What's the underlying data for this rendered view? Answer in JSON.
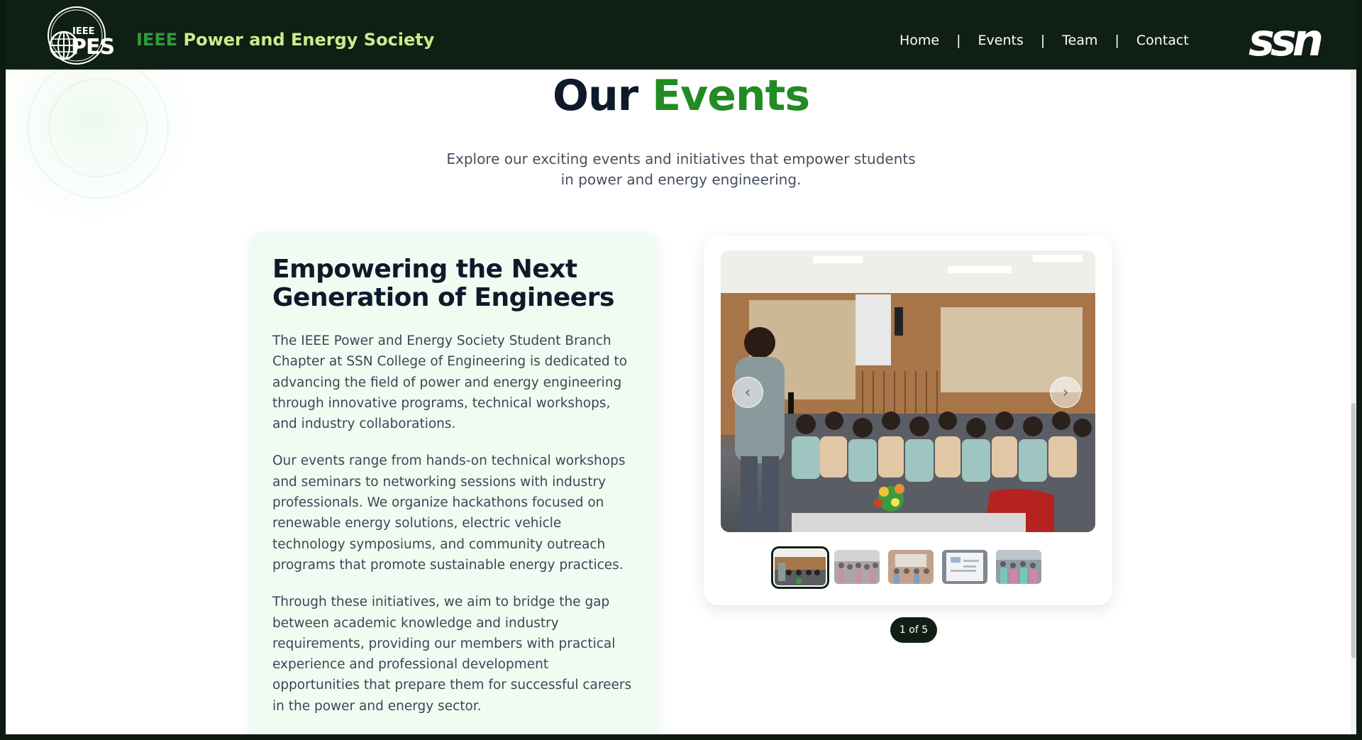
{
  "header": {
    "brand_ieee": "IEEE",
    "brand_rest": "Power and Energy Society",
    "logo_top": "IEEE",
    "logo_bottom": "PES",
    "nav": [
      "Home",
      "Events",
      "Team",
      "Contact"
    ],
    "nav_separator": "|",
    "partner_logo_text": "ssn"
  },
  "hero": {
    "title_part1": "Our",
    "title_part2": "Events",
    "subtitle": "Explore our exciting events and initiatives that empower students in power and energy engineering."
  },
  "about": {
    "heading": "Empowering the Next Generation of Engineers",
    "paragraphs": [
      "The IEEE Power and Energy Society Student Branch Chapter at SSN College of Engineering is dedicated to advancing the field of power and energy engineering through innovative programs, technical workshops, and industry collaborations.",
      "Our events range from hands-on technical workshops and seminars to networking sessions with industry professionals. We organize hackathons focused on renewable energy solutions, electric vehicle technology symposiums, and community outreach programs that promote sustainable energy practices.",
      "Through these initiatives, we aim to bridge the gap between academic knowledge and industry requirements, providing our members with practical experience and professional development opportunities that prepare them for successful careers in the power and energy sector."
    ]
  },
  "carousel": {
    "prev_icon": "chevron-left-icon",
    "next_icon": "chevron-right-icon",
    "prev_glyph": "‹",
    "next_glyph": "›",
    "thumbnail_count": 5,
    "active_index": 1,
    "counter": "1 of 5"
  },
  "colors": {
    "header_bg": "#0f1f14",
    "accent_green": "#228b22",
    "brand_green": "#2f9c3a",
    "brand_light": "#c8ee8c",
    "card_bg": "#eefcf2",
    "title_dark": "#0e1a2b"
  }
}
